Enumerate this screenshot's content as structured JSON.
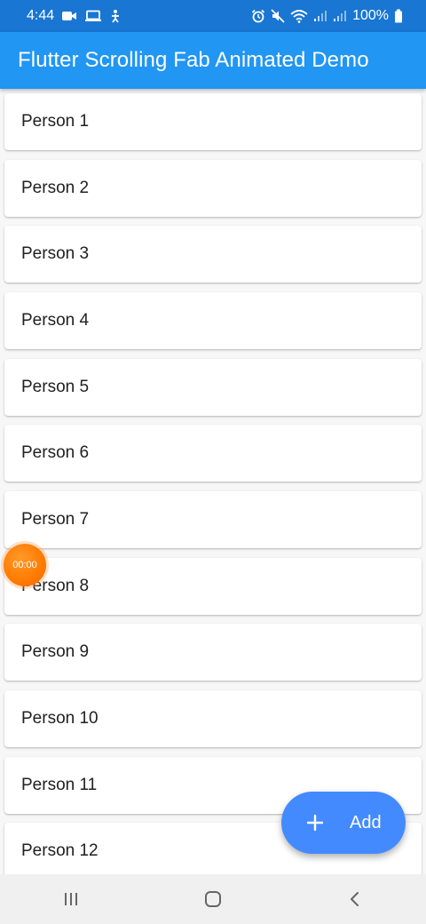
{
  "status_bar": {
    "time": "4:44",
    "battery_text": "100%",
    "left_icons": [
      "video-camera-icon",
      "laptop-icon",
      "accessibility-icon"
    ],
    "right_icons": [
      "alarm-icon",
      "mute-icon",
      "wifi-icon",
      "signal-icon",
      "signal-icon",
      "battery-icon"
    ]
  },
  "app_bar": {
    "title": "Flutter Scrolling Fab Animated Demo"
  },
  "list": {
    "items": [
      {
        "label": "Person 1"
      },
      {
        "label": "Person 2"
      },
      {
        "label": "Person 3"
      },
      {
        "label": "Person 4"
      },
      {
        "label": "Person 5"
      },
      {
        "label": "Person 6"
      },
      {
        "label": "Person 7"
      },
      {
        "label": "Person 8"
      },
      {
        "label": "Person 9"
      },
      {
        "label": "Person 10"
      },
      {
        "label": "Person 11"
      },
      {
        "label": "Person 12"
      }
    ]
  },
  "timer_bubble": {
    "text": "00:00"
  },
  "fab": {
    "icon": "plus-icon",
    "label": "Add"
  },
  "nav_bar": {
    "buttons": [
      "recent-apps-icon",
      "home-icon",
      "back-icon"
    ]
  },
  "colors": {
    "status_bar": "#1976d2",
    "app_bar": "#2196f3",
    "fab": "#448aff",
    "timer_bubble": "#ff7a00",
    "background": "#f7f7f7"
  }
}
